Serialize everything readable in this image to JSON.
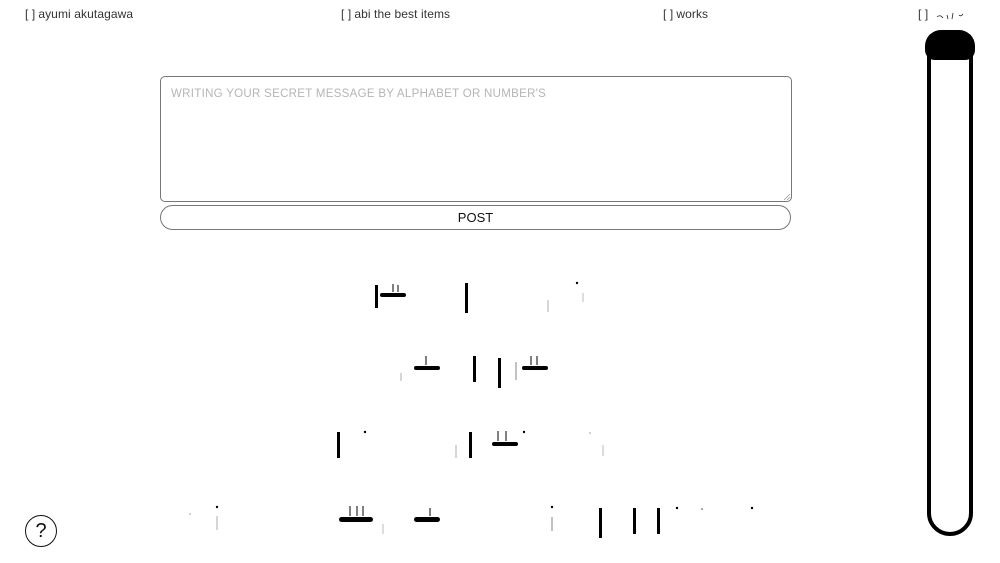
{
  "nav": {
    "bracket": "[   ]",
    "items": [
      {
        "label": "ayumi akutagawa"
      },
      {
        "label": "abi the best items"
      },
      {
        "label": "works"
      },
      {
        "label": ""
      }
    ]
  },
  "compose": {
    "placeholder": "WRITING YOUR SECRET MESSAGE BY ALPHABET OR NUMBER'S",
    "value": "",
    "post_label": "POST"
  },
  "help": {
    "label": "?"
  },
  "icons": {
    "help": "question-circle-icon",
    "scroll": "scrollbar-thumb"
  },
  "colors": {
    "background": "#ffffff",
    "ink": "#000000",
    "border": "#777777",
    "placeholder": "#b5b5b5"
  }
}
